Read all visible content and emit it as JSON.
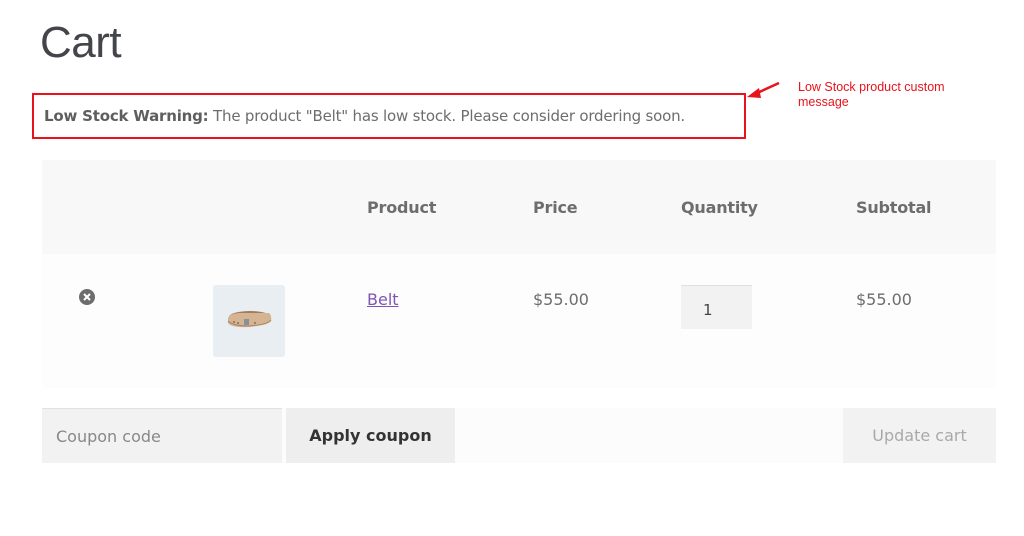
{
  "page": {
    "title": "Cart"
  },
  "notice": {
    "label": "Low Stock Warning:",
    "message": " The product \"Belt\" has low stock. Please consider ordering soon.",
    "border_color": "#e8131b"
  },
  "annotation": {
    "text": "Low Stock product custom message",
    "color": "#e8131b"
  },
  "cart": {
    "columns": [
      "",
      "",
      "Product",
      "Price",
      "Quantity",
      "Subtotal"
    ],
    "items": [
      {
        "remove_icon": "remove-circle-x-icon",
        "thumbnail": "belt-product-image",
        "product": "Belt",
        "price": "$55.00",
        "quantity": "1",
        "subtotal": "$55.00"
      }
    ]
  },
  "actions": {
    "coupon_placeholder": "Coupon code",
    "coupon_value": "",
    "apply_label": "Apply coupon",
    "update_label": "Update cart"
  },
  "colors": {
    "link": "#7f54b3",
    "accent_red": "#e8131b"
  }
}
